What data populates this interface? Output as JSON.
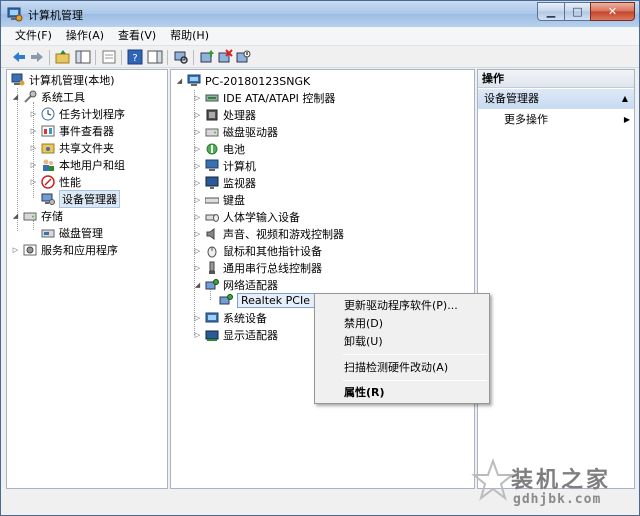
{
  "window": {
    "title": "计算机管理"
  },
  "menubar": [
    "文件(F)",
    "操作(A)",
    "查看(V)",
    "帮助(H)"
  ],
  "left_tree": {
    "root": "计算机管理(本地)",
    "system_tools": "系统工具",
    "task_scheduler": "任务计划程序",
    "event_viewer": "事件查看器",
    "shared_folders": "共享文件夹",
    "local_users": "本地用户和组",
    "performance": "性能",
    "device_manager": "设备管理器",
    "storage": "存储",
    "disk_management": "磁盘管理",
    "services": "服务和应用程序"
  },
  "device_tree": {
    "computer": "PC-20180123SNGK",
    "categories": [
      "IDE ATA/ATAPI 控制器",
      "处理器",
      "磁盘驱动器",
      "电池",
      "计算机",
      "监视器",
      "键盘",
      "人体学输入设备",
      "声音、视频和游戏控制器",
      "鼠标和其他指针设备",
      "通用串行总线控制器",
      "网络适配器"
    ],
    "network_device": "Realtek PCIe GB",
    "after": [
      "系统设备",
      "显示适配器"
    ]
  },
  "actions": {
    "header": "操作",
    "group": "设备管理器",
    "more": "更多操作"
  },
  "context_menu": {
    "update": "更新驱动程序软件(P)...",
    "disable": "禁用(D)",
    "uninstall": "卸载(U)",
    "scan": "扫描检测硬件改动(A)",
    "properties": "属性(R)"
  },
  "watermark": {
    "cn": "装机之家",
    "url": "gdhjbk.com"
  }
}
